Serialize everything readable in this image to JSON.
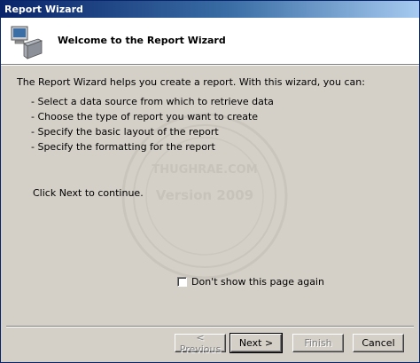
{
  "window": {
    "title": "Report Wizard"
  },
  "header": {
    "title": "Welcome to the Report Wizard",
    "icon": "computer-icon"
  },
  "body": {
    "intro": "The Report Wizard helps you create a report. With this wizard, you can:",
    "bullets": [
      "- Select a data source from which to retrieve data",
      "- Choose the type of report you want to create",
      "- Specify the basic layout of the report",
      "- Specify the formatting for the report"
    ],
    "next_hint": "Click Next to continue."
  },
  "dont_show": {
    "label": "Don't show this page again",
    "checked": false
  },
  "buttons": {
    "previous": "< Previous",
    "next": "Next >",
    "finish": "Finish",
    "cancel": "Cancel"
  },
  "watermark": {
    "line1": "THUGHRAE.COM",
    "line2": "Version 2009"
  }
}
